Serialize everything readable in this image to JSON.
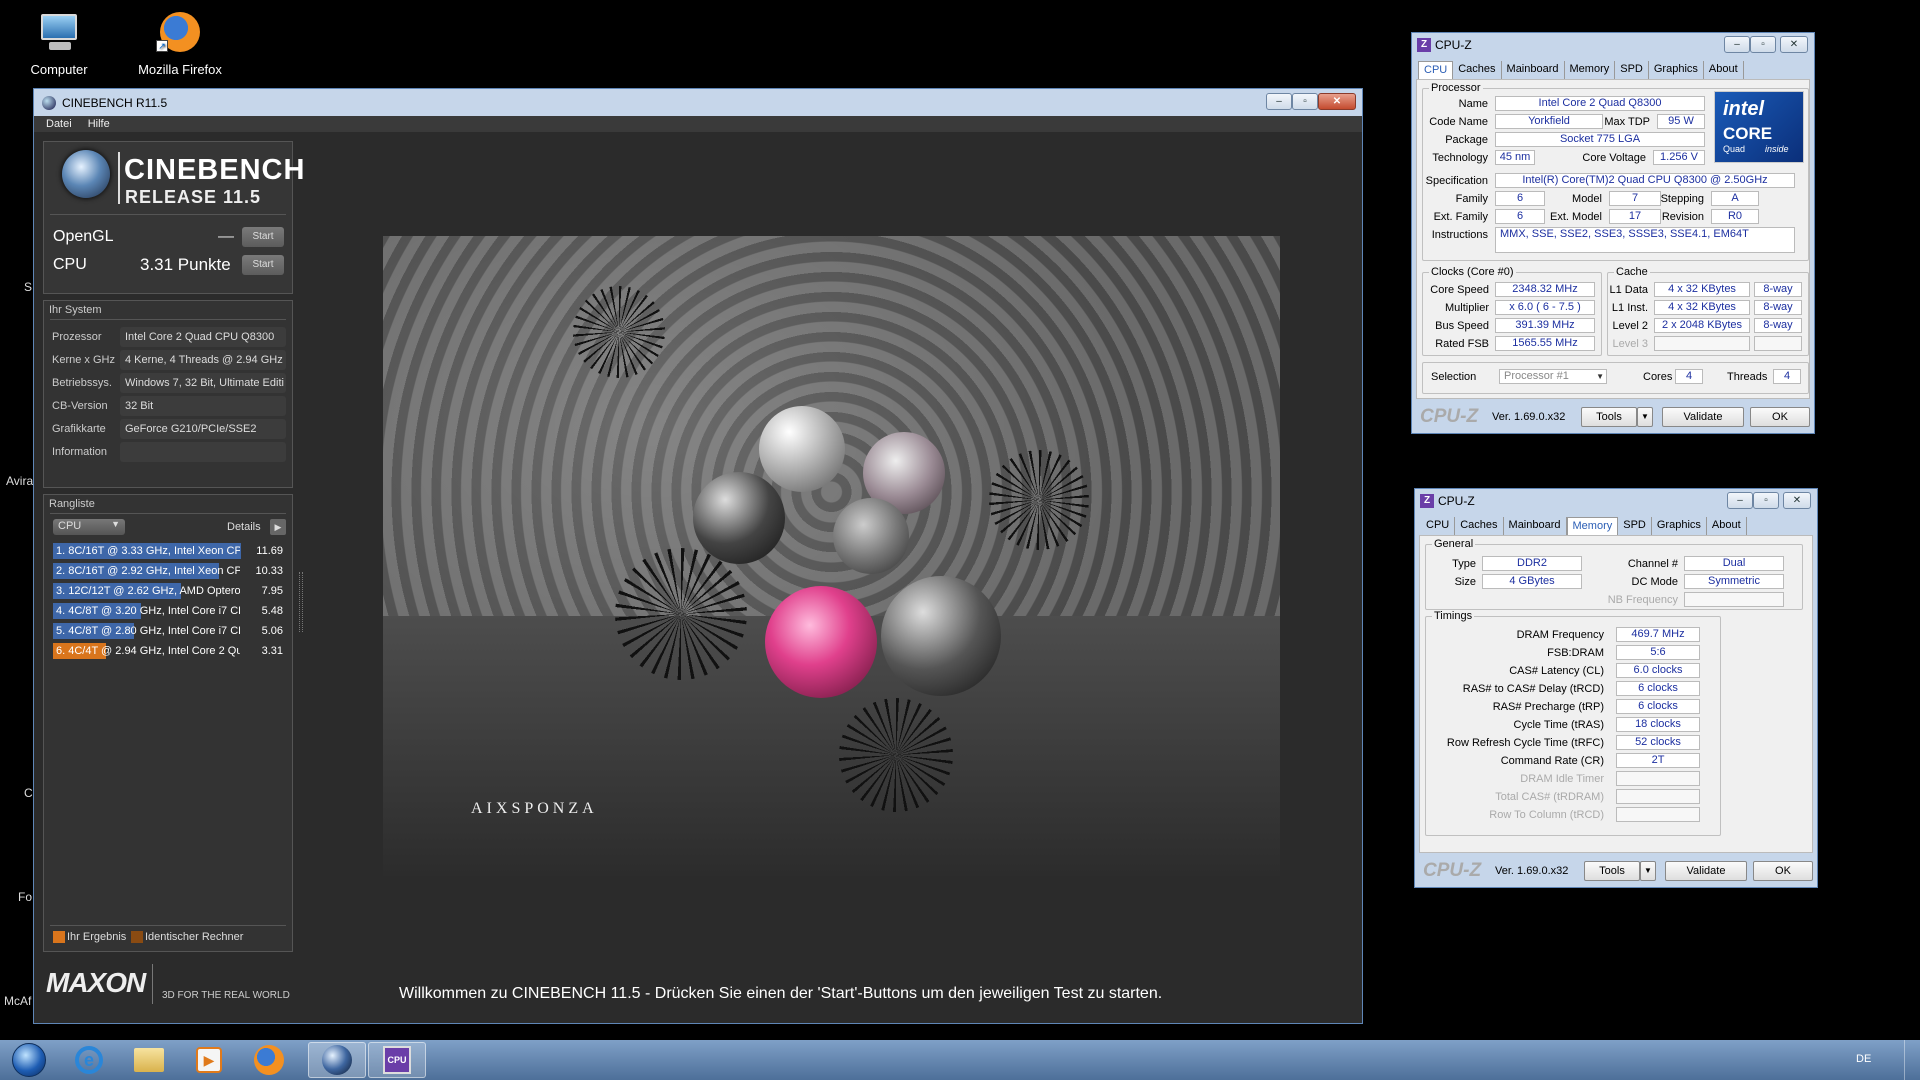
{
  "desktop": {
    "icons": [
      {
        "label": "Computer",
        "icon": "computer-icon"
      },
      {
        "label": "Mozilla Firefox",
        "icon": "firefox-icon"
      }
    ],
    "edge_labels": [
      "S",
      "Avira",
      "C",
      "Fo",
      "McAf"
    ]
  },
  "cinebench": {
    "window_title": "CINEBENCH R11.5",
    "menu": [
      "Datei",
      "Hilfe"
    ],
    "logo_title": "CINEBENCH",
    "logo_release": "RELEASE 11.5",
    "opengl": {
      "label": "OpenGL",
      "value": "—",
      "button": "Start"
    },
    "cpu": {
      "label": "CPU",
      "value": "3.31 Punkte",
      "button": "Start"
    },
    "system_title": "Ihr System",
    "system": [
      {
        "key": "Prozessor",
        "value": "Intel Core 2 Quad CPU Q8300"
      },
      {
        "key": "Kerne x GHz",
        "value": "4 Kerne, 4 Threads @ 2.94 GHz"
      },
      {
        "key": "Betriebssys.",
        "value": "Windows 7, 32 Bit, Ultimate Editi"
      },
      {
        "key": "CB-Version",
        "value": "32 Bit"
      },
      {
        "key": "Grafikkarte",
        "value": "GeForce G210/PCIe/SSE2"
      },
      {
        "key": "Information",
        "value": ""
      }
    ],
    "ranking_title": "Rangliste",
    "ranking_select": "CPU",
    "ranking_details": "Details",
    "ranking": [
      {
        "label": "1. 8C/16T @ 3.33 GHz, Intel Xeon CP",
        "score": "11.69",
        "fraction": 1.0,
        "type": "other"
      },
      {
        "label": "2. 8C/16T @ 2.92 GHz, Intel Xeon CP",
        "score": "10.33",
        "fraction": 0.884,
        "type": "other"
      },
      {
        "label": "3. 12C/12T @ 2.62 GHz, AMD Opteron",
        "score": "7.95",
        "fraction": 0.68,
        "type": "other"
      },
      {
        "label": "4. 4C/8T @ 3.20 GHz, Intel Core i7 CPI",
        "score": "5.48",
        "fraction": 0.469,
        "type": "other"
      },
      {
        "label": "5. 4C/8T @ 2.80 GHz, Intel Core i7 CPI",
        "score": "5.06",
        "fraction": 0.433,
        "type": "other"
      },
      {
        "label": "6. 4C/4T @ 2.94 GHz, Intel Core 2 Qua",
        "score": "3.31",
        "fraction": 0.283,
        "type": "own"
      }
    ],
    "legend": {
      "own": "Ihr Ergebnis",
      "identical": "Identischer Rechner"
    },
    "maxon": {
      "name": "MAXON",
      "tagline": "3D FOR THE REAL WORLD"
    },
    "render_watermark": "AIXSPONZA",
    "status": "Willkommen zu CINEBENCH 11.5 - Drücken Sie einen der 'Start'-Buttons um den jeweiligen Test zu starten.",
    "colors": {
      "own": "#d9751c",
      "other": "#3e67a9",
      "identical": "#8a4b12"
    }
  },
  "cpuz_cpu": {
    "title": "CPU-Z",
    "tabs": [
      "CPU",
      "Caches",
      "Mainboard",
      "Memory",
      "SPD",
      "Graphics",
      "About"
    ],
    "active_tab": "CPU",
    "processor_title": "Processor",
    "name_label": "Name",
    "name": "Intel Core 2 Quad Q8300",
    "codename_label": "Code Name",
    "codename": "Yorkfield",
    "maxtdp_label": "Max TDP",
    "maxtdp": "95 W",
    "package_label": "Package",
    "package": "Socket 775 LGA",
    "tech_label": "Technology",
    "tech": "45 nm",
    "voltage_label": "Core Voltage",
    "voltage": "1.256 V",
    "spec_label": "Specification",
    "spec": "Intel(R) Core(TM)2 Quad CPU    Q8300  @ 2.50GHz",
    "family_label": "Family",
    "family": "6",
    "model_label": "Model",
    "model": "7",
    "stepping_label": "Stepping",
    "stepping": "A",
    "extfamily_label": "Ext. Family",
    "extfamily": "6",
    "extmodel_label": "Ext. Model",
    "extmodel": "17",
    "revision_label": "Revision",
    "revision": "R0",
    "instr_label": "Instructions",
    "instr": "MMX, SSE, SSE2, SSE3, SSSE3, SSE4.1, EM64T",
    "intel_logo": {
      "brand": "intel",
      "line": "CORE",
      "sub": "Quad",
      "inside": "inside"
    },
    "clocks_title": "Clocks (Core #0)",
    "corespeed_label": "Core Speed",
    "corespeed": "2348.32 MHz",
    "multiplier_label": "Multiplier",
    "multiplier": "x 6.0 ( 6 - 7.5 )",
    "busspeed_label": "Bus Speed",
    "busspeed": "391.39 MHz",
    "ratedfsb_label": "Rated FSB",
    "ratedfsb": "1565.55 MHz",
    "cache_title": "Cache",
    "l1d_label": "L1 Data",
    "l1d": "4 x 32 KBytes",
    "l1d_way": "8-way",
    "l1i_label": "L1 Inst.",
    "l1i": "4 x 32 KBytes",
    "l1i_way": "8-way",
    "l2_label": "Level 2",
    "l2": "2 x 2048 KBytes",
    "l2_way": "8-way",
    "l3_label": "Level 3",
    "selection_label": "Selection",
    "selection": "Processor #1",
    "cores_label": "Cores",
    "cores": "4",
    "threads_label": "Threads",
    "threads": "4",
    "footer_logo": "CPU-Z",
    "version": "Ver. 1.69.0.x32",
    "tools": "Tools",
    "validate": "Validate",
    "ok": "OK"
  },
  "cpuz_mem": {
    "title": "CPU-Z",
    "tabs": [
      "CPU",
      "Caches",
      "Mainboard",
      "Memory",
      "SPD",
      "Graphics",
      "About"
    ],
    "active_tab": "Memory",
    "general_title": "General",
    "type_label": "Type",
    "type": "DDR2",
    "channel_label": "Channel #",
    "channel": "Dual",
    "size_label": "Size",
    "size": "4 GBytes",
    "dcmode_label": "DC Mode",
    "dcmode": "Symmetric",
    "nbfreq_label": "NB Frequency",
    "timings_title": "Timings",
    "timings": [
      {
        "label": "DRAM Frequency",
        "value": "469.7 MHz",
        "dim": false
      },
      {
        "label": "FSB:DRAM",
        "value": "5:6",
        "dim": false
      },
      {
        "label": "CAS# Latency (CL)",
        "value": "6.0 clocks",
        "dim": false
      },
      {
        "label": "RAS# to CAS# Delay (tRCD)",
        "value": "6 clocks",
        "dim": false
      },
      {
        "label": "RAS# Precharge (tRP)",
        "value": "6 clocks",
        "dim": false
      },
      {
        "label": "Cycle Time (tRAS)",
        "value": "18 clocks",
        "dim": false
      },
      {
        "label": "Row Refresh Cycle Time (tRFC)",
        "value": "52 clocks",
        "dim": false
      },
      {
        "label": "Command Rate (CR)",
        "value": "2T",
        "dim": false
      },
      {
        "label": "DRAM Idle Timer",
        "value": "",
        "dim": true
      },
      {
        "label": "Total CAS# (tRDRAM)",
        "value": "",
        "dim": true
      },
      {
        "label": "Row To Column (tRCD)",
        "value": "",
        "dim": true
      }
    ],
    "footer_logo": "CPU-Z",
    "version": "Ver. 1.69.0.x32",
    "tools": "Tools",
    "validate": "Validate",
    "ok": "OK"
  },
  "taskbar": {
    "items": [
      "start-orb-icon",
      "internet-explorer-icon",
      "explorer-folder-icon",
      "media-player-icon",
      "firefox-icon",
      "cinebench-icon",
      "cpuz-icon"
    ],
    "language": "DE"
  }
}
